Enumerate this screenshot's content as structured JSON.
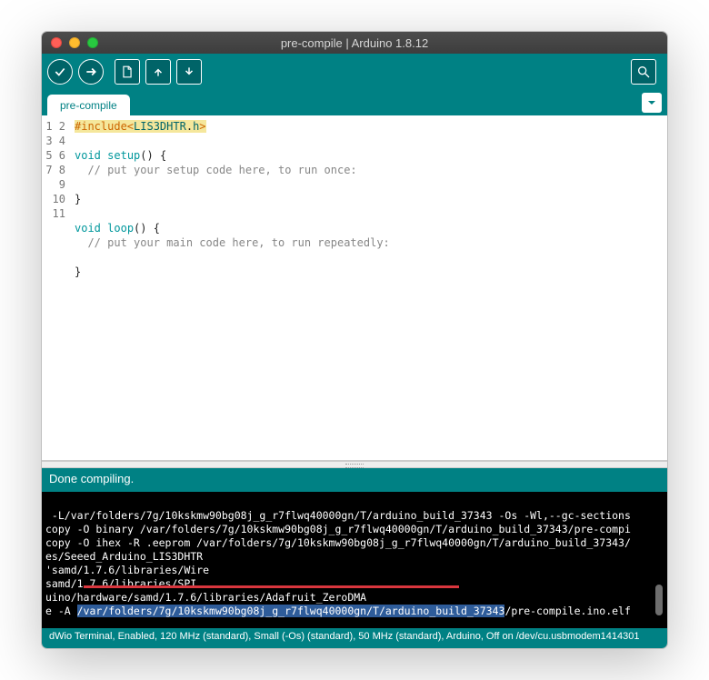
{
  "window": {
    "title": "pre-compile | Arduino 1.8.12"
  },
  "tabs": {
    "active": "pre-compile"
  },
  "code": {
    "lines": [
      1,
      2,
      3,
      4,
      5,
      6,
      7,
      8,
      9,
      10,
      11
    ],
    "include_kw": "#include",
    "include_lt": "<",
    "include_lib": "LIS3DHTR",
    "include_dot": ".",
    "include_ext": "h",
    "include_gt": ">",
    "void": "void",
    "setup": "setup",
    "setup_sig": "() {",
    "setup_comment": "  // put your setup code here, to run once:",
    "close_brace": "}",
    "loop": "loop",
    "loop_sig": "() {",
    "loop_comment": "  // put your main code here, to run repeatedly:"
  },
  "status": {
    "message": "Done compiling."
  },
  "console": {
    "l1": " -L/var/folders/7g/10kskmw90bg08j_g_r7flwq40000gn/T/arduino_build_37343 -Os -Wl,--gc-sections",
    "l2": "copy -O binary /var/folders/7g/10kskmw90bg08j_g_r7flwq40000gn/T/arduino_build_37343/pre-compi",
    "l3": "copy -O ihex -R .eeprom /var/folders/7g/10kskmw90bg08j_g_r7flwq40000gn/T/arduino_build_37343/",
    "l4": "es/Seeed_Arduino_LIS3DHTR",
    "l5": "'samd/1.7.6/libraries/Wire",
    "l6": "samd/1.7.6/libraries/SPI",
    "l7": "uino/hardware/samd/1.7.6/libraries/Adafruit_ZeroDMA",
    "l8a": "e -A ",
    "l8b": "/var/folders/7g/10kskmw90bg08j_g_r7flwq40000gn/T/arduino_build_37343",
    "l8c": "/pre-compile.ino.elf"
  },
  "footer": {
    "text": "dWio Terminal, Enabled, 120 MHz (standard), Small (-Os) (standard), 50 MHz (standard), Arduino, Off on /dev/cu.usbmodem1414301"
  }
}
